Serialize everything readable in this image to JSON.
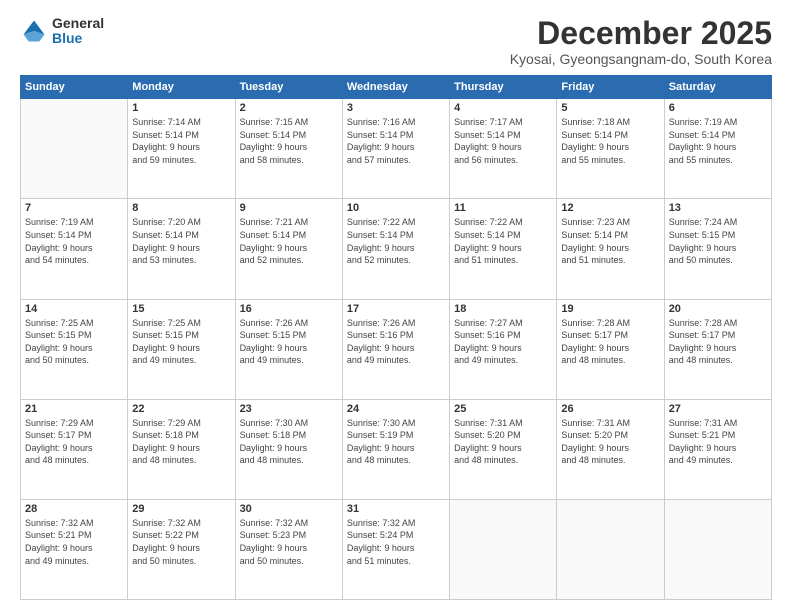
{
  "logo": {
    "general": "General",
    "blue": "Blue"
  },
  "title": "December 2025",
  "subtitle": "Kyosai, Gyeongsangnam-do, South Korea",
  "days": [
    "Sunday",
    "Monday",
    "Tuesday",
    "Wednesday",
    "Thursday",
    "Friday",
    "Saturday"
  ],
  "weeks": [
    [
      {
        "num": "",
        "lines": []
      },
      {
        "num": "1",
        "lines": [
          "Sunrise: 7:14 AM",
          "Sunset: 5:14 PM",
          "Daylight: 9 hours",
          "and 59 minutes."
        ]
      },
      {
        "num": "2",
        "lines": [
          "Sunrise: 7:15 AM",
          "Sunset: 5:14 PM",
          "Daylight: 9 hours",
          "and 58 minutes."
        ]
      },
      {
        "num": "3",
        "lines": [
          "Sunrise: 7:16 AM",
          "Sunset: 5:14 PM",
          "Daylight: 9 hours",
          "and 57 minutes."
        ]
      },
      {
        "num": "4",
        "lines": [
          "Sunrise: 7:17 AM",
          "Sunset: 5:14 PM",
          "Daylight: 9 hours",
          "and 56 minutes."
        ]
      },
      {
        "num": "5",
        "lines": [
          "Sunrise: 7:18 AM",
          "Sunset: 5:14 PM",
          "Daylight: 9 hours",
          "and 55 minutes."
        ]
      },
      {
        "num": "6",
        "lines": [
          "Sunrise: 7:19 AM",
          "Sunset: 5:14 PM",
          "Daylight: 9 hours",
          "and 55 minutes."
        ]
      }
    ],
    [
      {
        "num": "7",
        "lines": [
          "Sunrise: 7:19 AM",
          "Sunset: 5:14 PM",
          "Daylight: 9 hours",
          "and 54 minutes."
        ]
      },
      {
        "num": "8",
        "lines": [
          "Sunrise: 7:20 AM",
          "Sunset: 5:14 PM",
          "Daylight: 9 hours",
          "and 53 minutes."
        ]
      },
      {
        "num": "9",
        "lines": [
          "Sunrise: 7:21 AM",
          "Sunset: 5:14 PM",
          "Daylight: 9 hours",
          "and 52 minutes."
        ]
      },
      {
        "num": "10",
        "lines": [
          "Sunrise: 7:22 AM",
          "Sunset: 5:14 PM",
          "Daylight: 9 hours",
          "and 52 minutes."
        ]
      },
      {
        "num": "11",
        "lines": [
          "Sunrise: 7:22 AM",
          "Sunset: 5:14 PM",
          "Daylight: 9 hours",
          "and 51 minutes."
        ]
      },
      {
        "num": "12",
        "lines": [
          "Sunrise: 7:23 AM",
          "Sunset: 5:14 PM",
          "Daylight: 9 hours",
          "and 51 minutes."
        ]
      },
      {
        "num": "13",
        "lines": [
          "Sunrise: 7:24 AM",
          "Sunset: 5:15 PM",
          "Daylight: 9 hours",
          "and 50 minutes."
        ]
      }
    ],
    [
      {
        "num": "14",
        "lines": [
          "Sunrise: 7:25 AM",
          "Sunset: 5:15 PM",
          "Daylight: 9 hours",
          "and 50 minutes."
        ]
      },
      {
        "num": "15",
        "lines": [
          "Sunrise: 7:25 AM",
          "Sunset: 5:15 PM",
          "Daylight: 9 hours",
          "and 49 minutes."
        ]
      },
      {
        "num": "16",
        "lines": [
          "Sunrise: 7:26 AM",
          "Sunset: 5:15 PM",
          "Daylight: 9 hours",
          "and 49 minutes."
        ]
      },
      {
        "num": "17",
        "lines": [
          "Sunrise: 7:26 AM",
          "Sunset: 5:16 PM",
          "Daylight: 9 hours",
          "and 49 minutes."
        ]
      },
      {
        "num": "18",
        "lines": [
          "Sunrise: 7:27 AM",
          "Sunset: 5:16 PM",
          "Daylight: 9 hours",
          "and 49 minutes."
        ]
      },
      {
        "num": "19",
        "lines": [
          "Sunrise: 7:28 AM",
          "Sunset: 5:17 PM",
          "Daylight: 9 hours",
          "and 48 minutes."
        ]
      },
      {
        "num": "20",
        "lines": [
          "Sunrise: 7:28 AM",
          "Sunset: 5:17 PM",
          "Daylight: 9 hours",
          "and 48 minutes."
        ]
      }
    ],
    [
      {
        "num": "21",
        "lines": [
          "Sunrise: 7:29 AM",
          "Sunset: 5:17 PM",
          "Daylight: 9 hours",
          "and 48 minutes."
        ]
      },
      {
        "num": "22",
        "lines": [
          "Sunrise: 7:29 AM",
          "Sunset: 5:18 PM",
          "Daylight: 9 hours",
          "and 48 minutes."
        ]
      },
      {
        "num": "23",
        "lines": [
          "Sunrise: 7:30 AM",
          "Sunset: 5:18 PM",
          "Daylight: 9 hours",
          "and 48 minutes."
        ]
      },
      {
        "num": "24",
        "lines": [
          "Sunrise: 7:30 AM",
          "Sunset: 5:19 PM",
          "Daylight: 9 hours",
          "and 48 minutes."
        ]
      },
      {
        "num": "25",
        "lines": [
          "Sunrise: 7:31 AM",
          "Sunset: 5:20 PM",
          "Daylight: 9 hours",
          "and 48 minutes."
        ]
      },
      {
        "num": "26",
        "lines": [
          "Sunrise: 7:31 AM",
          "Sunset: 5:20 PM",
          "Daylight: 9 hours",
          "and 48 minutes."
        ]
      },
      {
        "num": "27",
        "lines": [
          "Sunrise: 7:31 AM",
          "Sunset: 5:21 PM",
          "Daylight: 9 hours",
          "and 49 minutes."
        ]
      }
    ],
    [
      {
        "num": "28",
        "lines": [
          "Sunrise: 7:32 AM",
          "Sunset: 5:21 PM",
          "Daylight: 9 hours",
          "and 49 minutes."
        ]
      },
      {
        "num": "29",
        "lines": [
          "Sunrise: 7:32 AM",
          "Sunset: 5:22 PM",
          "Daylight: 9 hours",
          "and 50 minutes."
        ]
      },
      {
        "num": "30",
        "lines": [
          "Sunrise: 7:32 AM",
          "Sunset: 5:23 PM",
          "Daylight: 9 hours",
          "and 50 minutes."
        ]
      },
      {
        "num": "31",
        "lines": [
          "Sunrise: 7:32 AM",
          "Sunset: 5:24 PM",
          "Daylight: 9 hours",
          "and 51 minutes."
        ]
      },
      {
        "num": "",
        "lines": []
      },
      {
        "num": "",
        "lines": []
      },
      {
        "num": "",
        "lines": []
      }
    ]
  ]
}
